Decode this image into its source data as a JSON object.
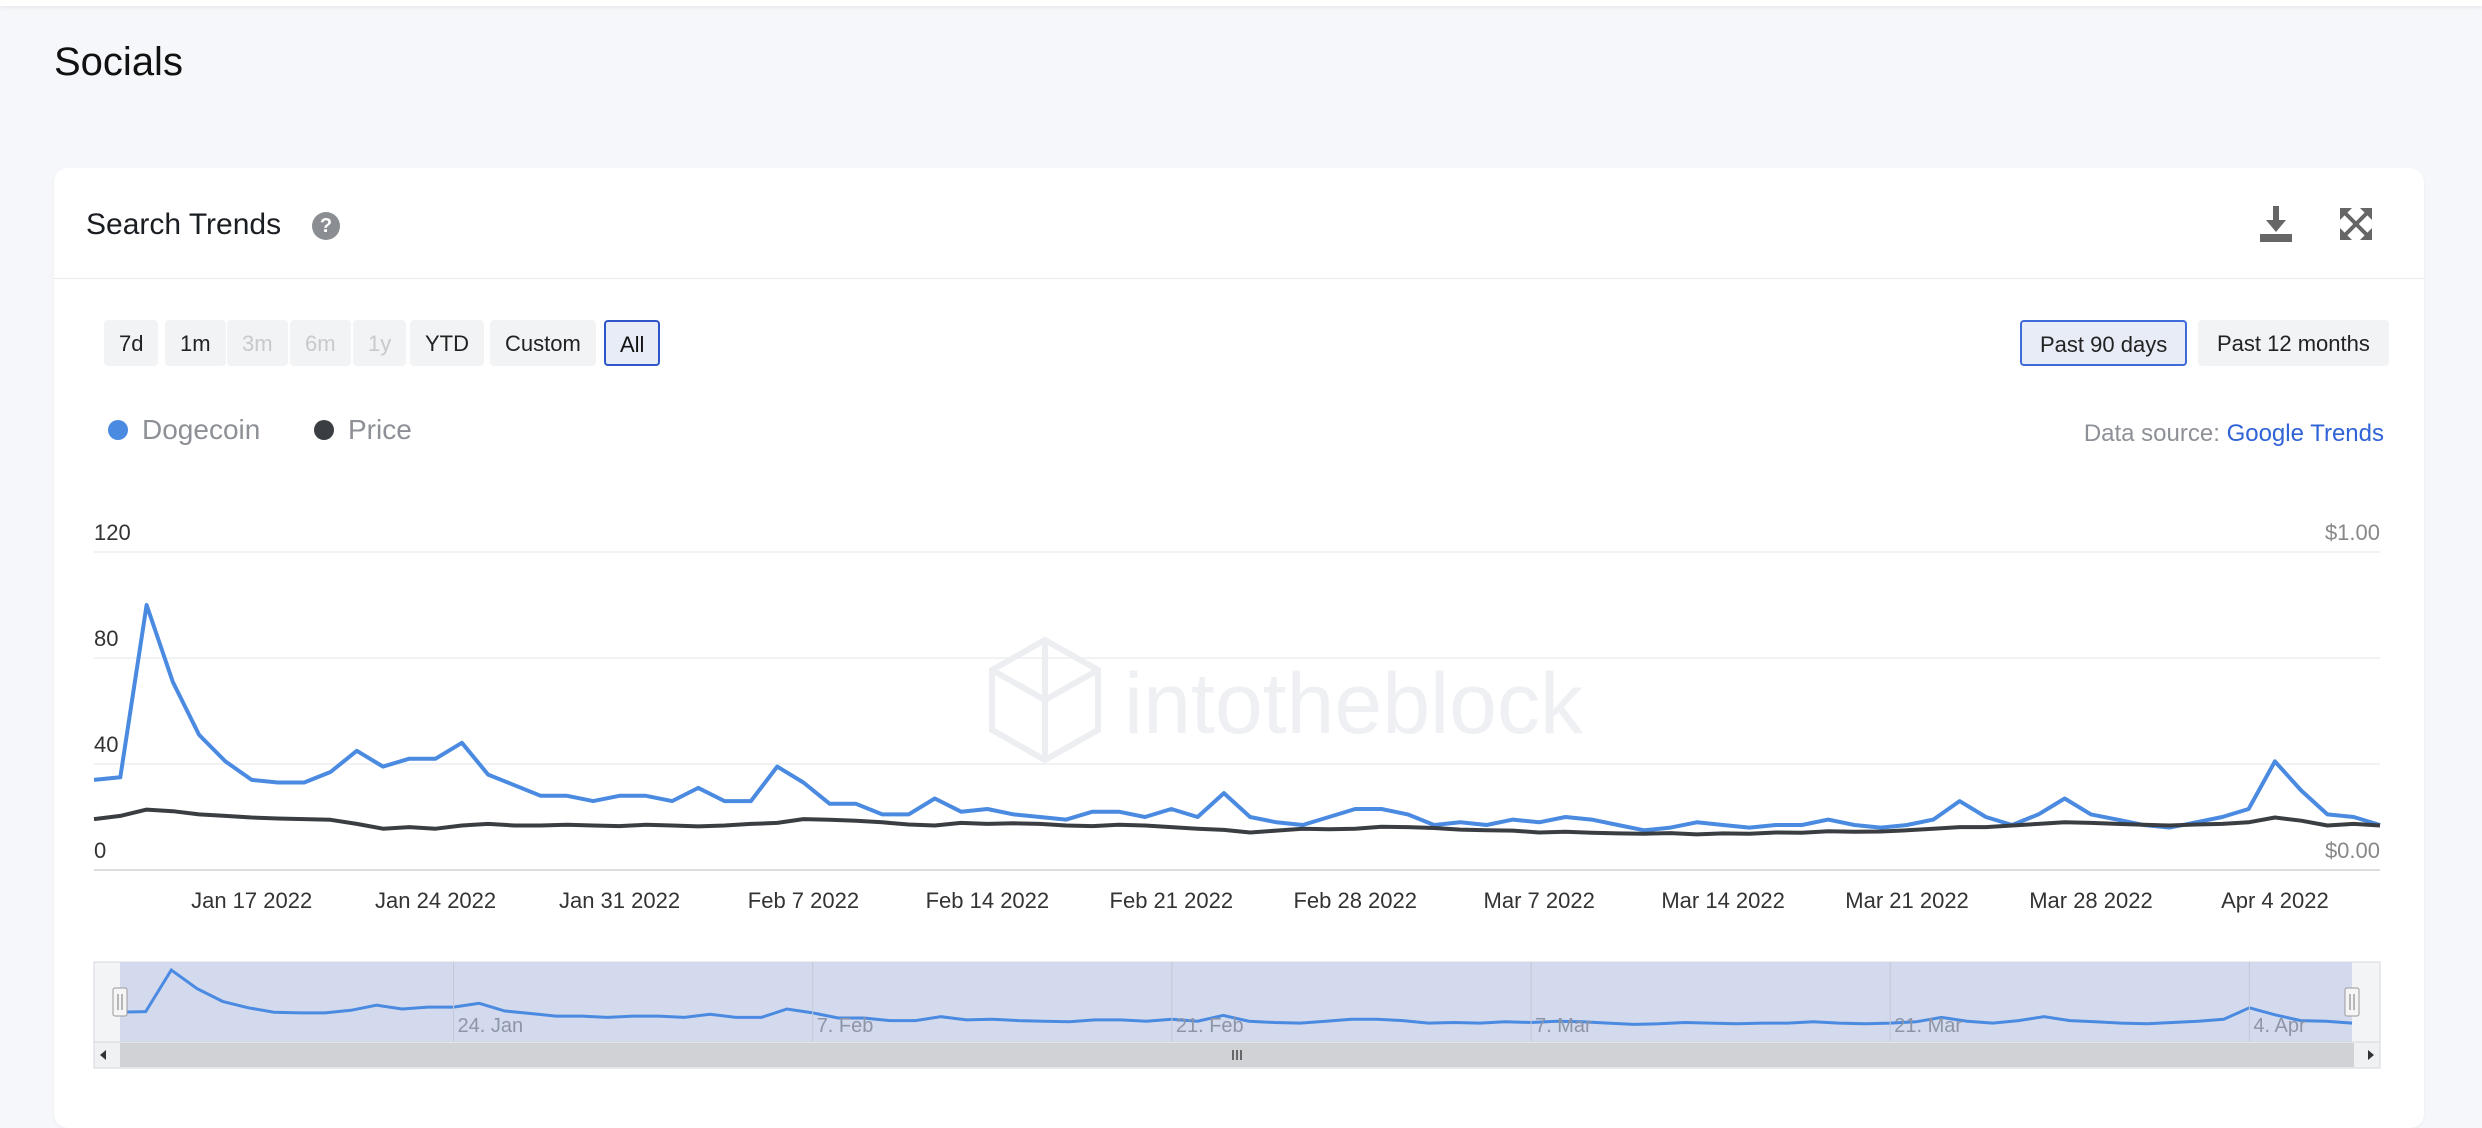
{
  "page": {
    "title": "Socials"
  },
  "card": {
    "title": "Search Trends",
    "help_symbol": "?",
    "ranges": [
      {
        "label": "7d",
        "state": "normal"
      },
      {
        "label": "1m",
        "state": "normal"
      },
      {
        "label": "3m",
        "state": "disabled"
      },
      {
        "label": "6m",
        "state": "disabled"
      },
      {
        "label": "1y",
        "state": "disabled"
      },
      {
        "label": "YTD",
        "state": "normal"
      },
      {
        "label": "Custom",
        "state": "normal"
      },
      {
        "label": "All",
        "state": "active"
      }
    ],
    "periods": [
      {
        "label": "Past 90 days",
        "state": "active"
      },
      {
        "label": "Past 12 months",
        "state": "normal"
      }
    ],
    "datasource_label": "Data source:",
    "datasource_link": "Google Trends",
    "watermark": "intotheblock",
    "icons": {
      "download": "download-icon",
      "expand": "expand-icon",
      "help": "help-icon"
    }
  },
  "colors": {
    "dogecoin": "#4a8ae0",
    "price": "#3a3d42",
    "accent": "#2e55c9",
    "link": "#2f63d6"
  },
  "chart_data": {
    "type": "line",
    "legend": [
      "Dogecoin",
      "Price"
    ],
    "left_axis": {
      "ticks": [
        "0",
        "40",
        "80",
        "120"
      ],
      "range": [
        0,
        120
      ]
    },
    "right_axis": {
      "ticks": [
        "$0.00",
        "$1.00"
      ],
      "range": [
        0,
        1
      ]
    },
    "x_ticks": [
      "Jan 17 2022",
      "Jan 24 2022",
      "Jan 31 2022",
      "Feb 7 2022",
      "Feb 14 2022",
      "Feb 21 2022",
      "Feb 28 2022",
      "Mar 7 2022",
      "Mar 14 2022",
      "Mar 21 2022",
      "Mar 28 2022",
      "Apr 4 2022"
    ],
    "navigator_ticks": [
      "24. Jan",
      "7. Feb",
      "21. Feb",
      "7. Mar",
      "21. Mar",
      "4. Apr"
    ],
    "x_start": "Jan 11 2022",
    "x_end": "Apr 7 2022",
    "series": [
      {
        "name": "Dogecoin",
        "axis": "left",
        "values": [
          34,
          35,
          100,
          71,
          51,
          41,
          34,
          33,
          33,
          37,
          45,
          39,
          42,
          42,
          48,
          36,
          32,
          28,
          28,
          26,
          28,
          28,
          26,
          31,
          26,
          26,
          39,
          33,
          25,
          25,
          21,
          21,
          27,
          22,
          23,
          21,
          20,
          19,
          22,
          22,
          20,
          23,
          20,
          29,
          20,
          18,
          17,
          20,
          23,
          23,
          21,
          17,
          18,
          17,
          19,
          18,
          20,
          19,
          17,
          15,
          16,
          18,
          17,
          16,
          17,
          17,
          19,
          17,
          16,
          17,
          19,
          26,
          20,
          17,
          21,
          27,
          21,
          19,
          17,
          16,
          18,
          20,
          23,
          41,
          30,
          21,
          20,
          17
        ]
      },
      {
        "name": "Price",
        "axis": "right",
        "values": [
          0.16,
          0.17,
          0.19,
          0.185,
          0.175,
          0.17,
          0.165,
          0.162,
          0.16,
          0.158,
          0.145,
          0.13,
          0.135,
          0.13,
          0.14,
          0.145,
          0.14,
          0.14,
          0.142,
          0.14,
          0.138,
          0.142,
          0.14,
          0.137,
          0.14,
          0.145,
          0.148,
          0.16,
          0.158,
          0.155,
          0.15,
          0.143,
          0.14,
          0.148,
          0.145,
          0.147,
          0.145,
          0.14,
          0.138,
          0.142,
          0.14,
          0.135,
          0.13,
          0.126,
          0.118,
          0.124,
          0.13,
          0.128,
          0.13,
          0.136,
          0.135,
          0.132,
          0.127,
          0.125,
          0.124,
          0.118,
          0.12,
          0.117,
          0.115,
          0.114,
          0.116,
          0.112,
          0.115,
          0.114,
          0.118,
          0.117,
          0.122,
          0.12,
          0.121,
          0.125,
          0.13,
          0.135,
          0.135,
          0.14,
          0.145,
          0.15,
          0.148,
          0.145,
          0.142,
          0.14,
          0.143,
          0.145,
          0.15,
          0.165,
          0.155,
          0.14,
          0.145,
          0.14
        ]
      }
    ]
  }
}
